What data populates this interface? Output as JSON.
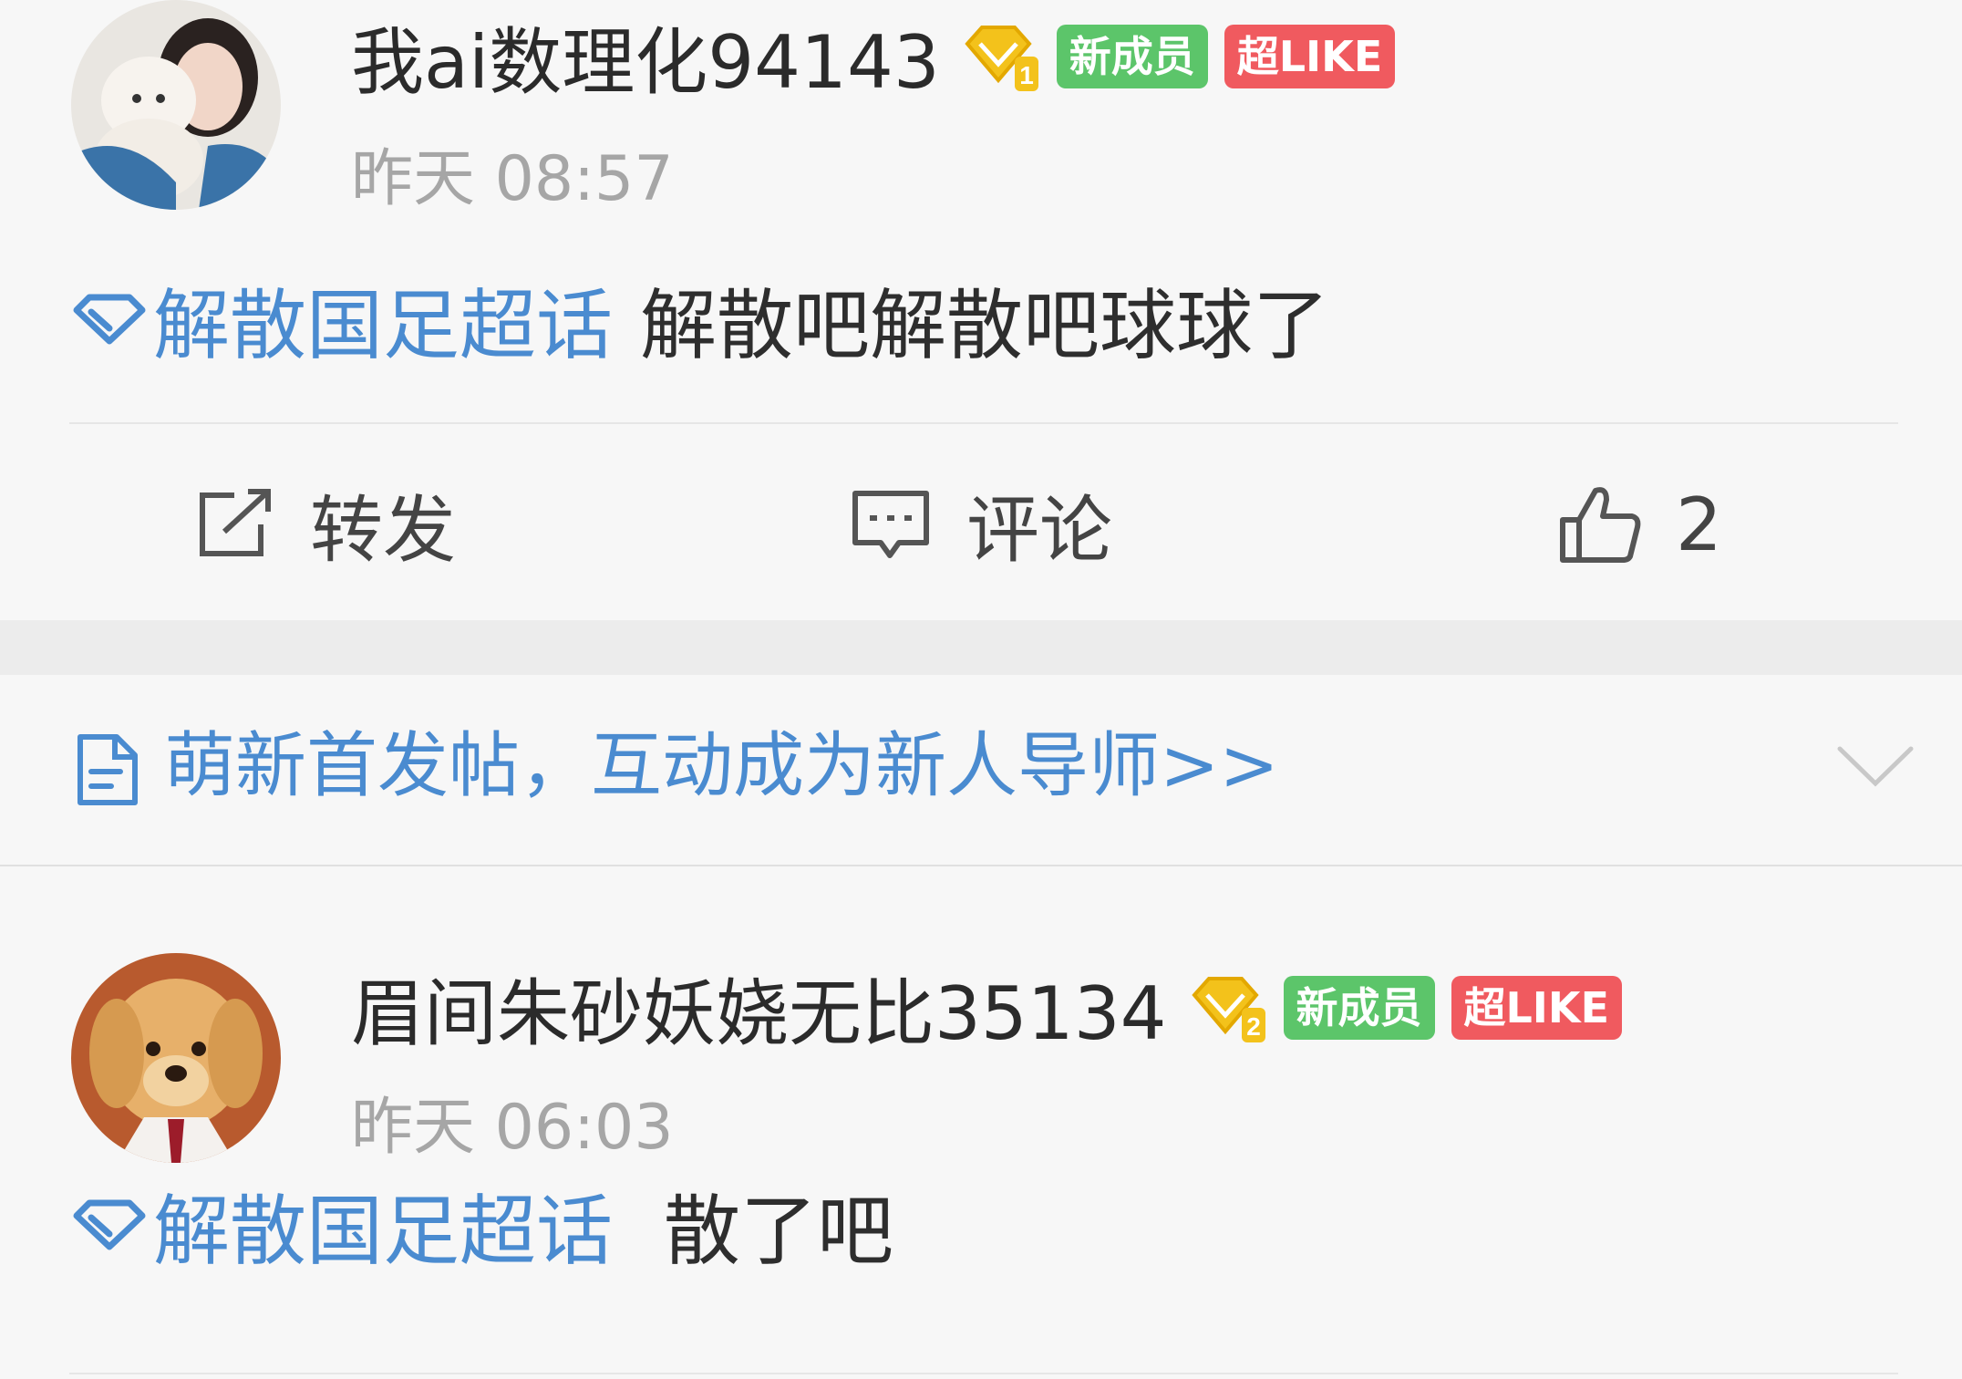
{
  "posts": [
    {
      "username": "我ai数理化94143",
      "level": "1",
      "tag_new": "新成员",
      "tag_like": "超LIKE",
      "time": "昨天 08:57",
      "topic": "解散国足超话",
      "text": "解散吧解散吧球球了",
      "actions": {
        "repost": "转发",
        "comment": "评论",
        "like_count": "2"
      }
    },
    {
      "username": "眉间朱砂妖娆无比35134",
      "level": "2",
      "tag_new": "新成员",
      "tag_like": "超LIKE",
      "time": "昨天 06:03",
      "topic": "解散国足超话",
      "text": "散了吧"
    }
  ],
  "notice": {
    "text": "萌新首发帖，互动成为新人导师>>"
  },
  "colors": {
    "topic_blue": "#4a8bd0",
    "tag_green": "#5cc56a",
    "tag_red": "#f05a5f",
    "badge_gold": "#f3c21b"
  }
}
